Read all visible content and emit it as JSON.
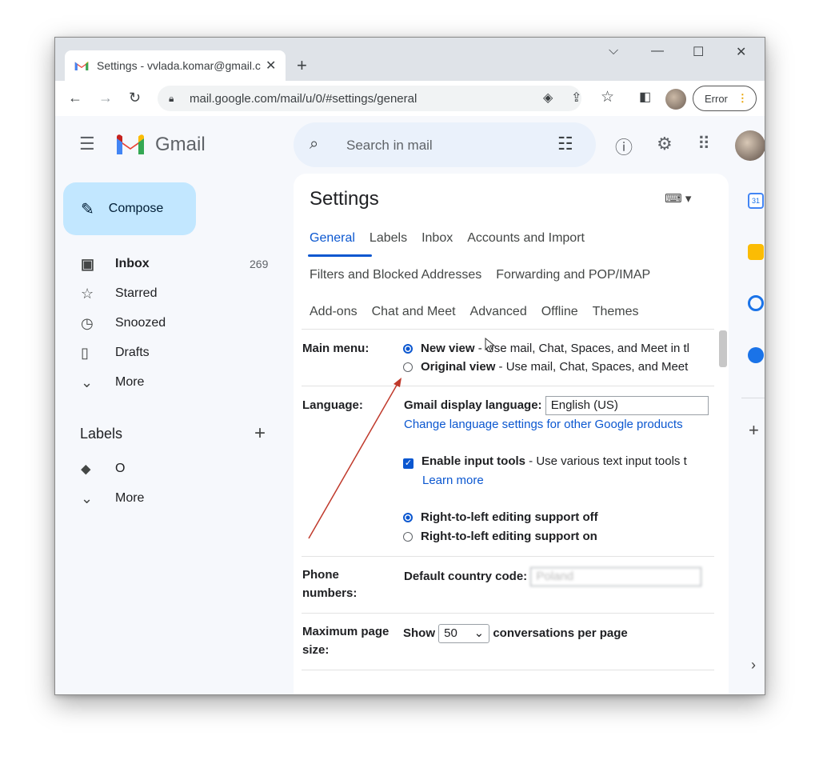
{
  "browser": {
    "tab_title": "Settings - vvlada.komar@gmail.c",
    "url": "mail.google.com/mail/u/0/#settings/general",
    "profile_button": "Error"
  },
  "gmail": {
    "logo_text": "Gmail",
    "search_placeholder": "Search in mail",
    "compose_label": "Compose",
    "nav": [
      {
        "label": "Inbox",
        "count": "269",
        "icon": "inbox-icon"
      },
      {
        "label": "Starred",
        "icon": "star-icon"
      },
      {
        "label": "Snoozed",
        "icon": "clock-icon"
      },
      {
        "label": "Drafts",
        "icon": "draft-icon"
      },
      {
        "label": "More",
        "icon": "chevron-down-icon"
      }
    ],
    "labels_heading": "Labels",
    "labels": [
      {
        "label": "O",
        "icon": "label-icon"
      },
      {
        "label": "More",
        "icon": "chevron-down-icon"
      }
    ]
  },
  "settings": {
    "title": "Settings",
    "tabs_row1": [
      "General",
      "Labels",
      "Inbox",
      "Accounts and Import"
    ],
    "tabs_row2": [
      "Filters and Blocked Addresses",
      "Forwarding and POP/IMAP"
    ],
    "tabs_row3": [
      "Add-ons",
      "Chat and Meet",
      "Advanced",
      "Offline",
      "Themes"
    ],
    "active_tab": "General",
    "main_menu": {
      "label": "Main menu:",
      "new_view_title": "New view",
      "new_view_desc": " - Use mail, Chat, Spaces, and Meet in tl",
      "original_view_title": "Original view",
      "original_view_desc": " - Use mail, Chat, Spaces, and Meet",
      "selected": "New view"
    },
    "language": {
      "label": "Language:",
      "display_language_label": "Gmail display language:",
      "display_language_value": "English (US)",
      "change_link": "Change language settings for other Google products",
      "input_tools_label": "Enable input tools",
      "input_tools_desc": " - Use various text input tools t",
      "input_tools_checked": true,
      "learn_more": "Learn more",
      "rtl_off": "Right-to-left editing support off",
      "rtl_on": "Right-to-left editing support on",
      "rtl_selected": "off"
    },
    "phone": {
      "label_line1": "Phone",
      "label_line2": "numbers:",
      "country_code_label": "Default country code:",
      "country_code_value": "Poland"
    },
    "page_size": {
      "label_line1": "Maximum page",
      "label_line2": "size:",
      "show_label": "Show",
      "value": "50",
      "suffix": "conversations per page"
    }
  },
  "colors": {
    "accent": "#0b57d0",
    "compose_bg": "#c2e7ff",
    "gmail_bg": "#f6f8fc",
    "annotation_arrow": "#c0392b"
  }
}
